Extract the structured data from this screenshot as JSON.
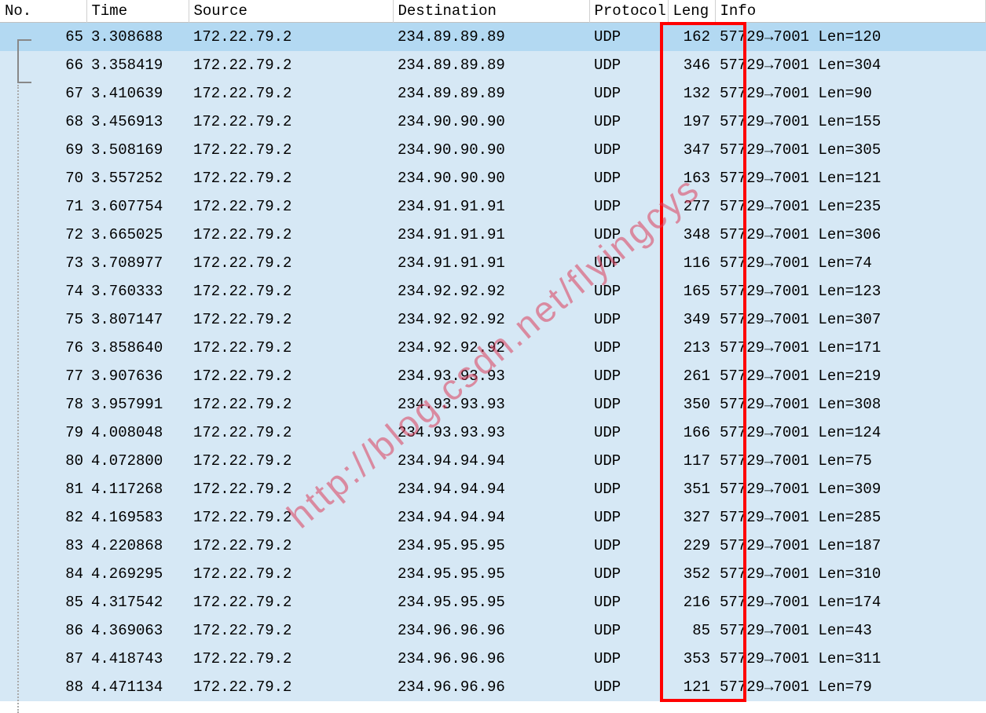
{
  "watermark": "http://blog.csdn.net/flyingcys",
  "columns": {
    "no": "No.",
    "time": "Time",
    "source": "Source",
    "destination": "Destination",
    "protocol": "Protocol",
    "length": "Leng",
    "info": "Info"
  },
  "packets": [
    {
      "no": "65",
      "time": "3.308688",
      "source": "172.22.79.2",
      "destination": "234.89.89.89",
      "protocol": "UDP",
      "length": "162",
      "info": "57729→7001 Len=120",
      "selected": true
    },
    {
      "no": "66",
      "time": "3.358419",
      "source": "172.22.79.2",
      "destination": "234.89.89.89",
      "protocol": "UDP",
      "length": "346",
      "info": "57729→7001 Len=304"
    },
    {
      "no": "67",
      "time": "3.410639",
      "source": "172.22.79.2",
      "destination": "234.89.89.89",
      "protocol": "UDP",
      "length": "132",
      "info": "57729→7001 Len=90"
    },
    {
      "no": "68",
      "time": "3.456913",
      "source": "172.22.79.2",
      "destination": "234.90.90.90",
      "protocol": "UDP",
      "length": "197",
      "info": "57729→7001 Len=155"
    },
    {
      "no": "69",
      "time": "3.508169",
      "source": "172.22.79.2",
      "destination": "234.90.90.90",
      "protocol": "UDP",
      "length": "347",
      "info": "57729→7001 Len=305"
    },
    {
      "no": "70",
      "time": "3.557252",
      "source": "172.22.79.2",
      "destination": "234.90.90.90",
      "protocol": "UDP",
      "length": "163",
      "info": "57729→7001 Len=121"
    },
    {
      "no": "71",
      "time": "3.607754",
      "source": "172.22.79.2",
      "destination": "234.91.91.91",
      "protocol": "UDP",
      "length": "277",
      "info": "57729→7001 Len=235"
    },
    {
      "no": "72",
      "time": "3.665025",
      "source": "172.22.79.2",
      "destination": "234.91.91.91",
      "protocol": "UDP",
      "length": "348",
      "info": "57729→7001 Len=306"
    },
    {
      "no": "73",
      "time": "3.708977",
      "source": "172.22.79.2",
      "destination": "234.91.91.91",
      "protocol": "UDP",
      "length": "116",
      "info": "57729→7001 Len=74"
    },
    {
      "no": "74",
      "time": "3.760333",
      "source": "172.22.79.2",
      "destination": "234.92.92.92",
      "protocol": "UDP",
      "length": "165",
      "info": "57729→7001 Len=123"
    },
    {
      "no": "75",
      "time": "3.807147",
      "source": "172.22.79.2",
      "destination": "234.92.92.92",
      "protocol": "UDP",
      "length": "349",
      "info": "57729→7001 Len=307"
    },
    {
      "no": "76",
      "time": "3.858640",
      "source": "172.22.79.2",
      "destination": "234.92.92.92",
      "protocol": "UDP",
      "length": "213",
      "info": "57729→7001 Len=171"
    },
    {
      "no": "77",
      "time": "3.907636",
      "source": "172.22.79.2",
      "destination": "234.93.93.93",
      "protocol": "UDP",
      "length": "261",
      "info": "57729→7001 Len=219"
    },
    {
      "no": "78",
      "time": "3.957991",
      "source": "172.22.79.2",
      "destination": "234.93.93.93",
      "protocol": "UDP",
      "length": "350",
      "info": "57729→7001 Len=308"
    },
    {
      "no": "79",
      "time": "4.008048",
      "source": "172.22.79.2",
      "destination": "234.93.93.93",
      "protocol": "UDP",
      "length": "166",
      "info": "57729→7001 Len=124"
    },
    {
      "no": "80",
      "time": "4.072800",
      "source": "172.22.79.2",
      "destination": "234.94.94.94",
      "protocol": "UDP",
      "length": "117",
      "info": "57729→7001 Len=75"
    },
    {
      "no": "81",
      "time": "4.117268",
      "source": "172.22.79.2",
      "destination": "234.94.94.94",
      "protocol": "UDP",
      "length": "351",
      "info": "57729→7001 Len=309"
    },
    {
      "no": "82",
      "time": "4.169583",
      "source": "172.22.79.2",
      "destination": "234.94.94.94",
      "protocol": "UDP",
      "length": "327",
      "info": "57729→7001 Len=285"
    },
    {
      "no": "83",
      "time": "4.220868",
      "source": "172.22.79.2",
      "destination": "234.95.95.95",
      "protocol": "UDP",
      "length": "229",
      "info": "57729→7001 Len=187"
    },
    {
      "no": "84",
      "time": "4.269295",
      "source": "172.22.79.2",
      "destination": "234.95.95.95",
      "protocol": "UDP",
      "length": "352",
      "info": "57729→7001 Len=310"
    },
    {
      "no": "85",
      "time": "4.317542",
      "source": "172.22.79.2",
      "destination": "234.95.95.95",
      "protocol": "UDP",
      "length": "216",
      "info": "57729→7001 Len=174"
    },
    {
      "no": "86",
      "time": "4.369063",
      "source": "172.22.79.2",
      "destination": "234.96.96.96",
      "protocol": "UDP",
      "length": "85",
      "info": "57729→7001 Len=43"
    },
    {
      "no": "87",
      "time": "4.418743",
      "source": "172.22.79.2",
      "destination": "234.96.96.96",
      "protocol": "UDP",
      "length": "353",
      "info": "57729→7001 Len=311"
    },
    {
      "no": "88",
      "time": "4.471134",
      "source": "172.22.79.2",
      "destination": "234.96.96.96",
      "protocol": "UDP",
      "length": "121",
      "info": "57729→7001 Len=79"
    }
  ]
}
